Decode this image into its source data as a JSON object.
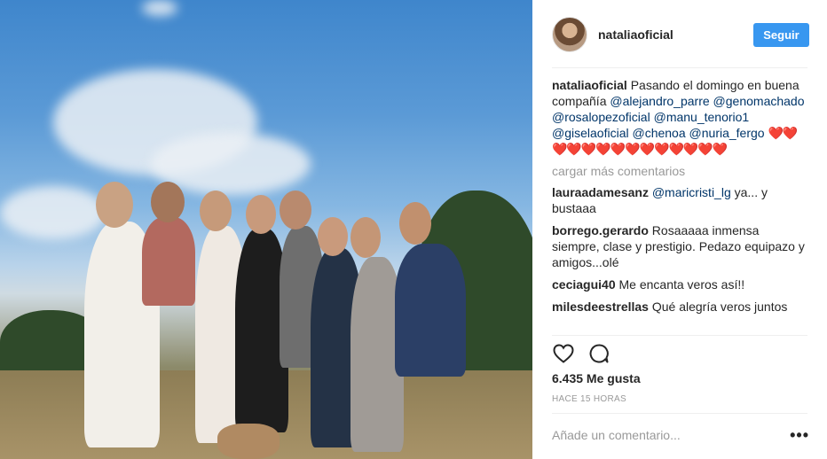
{
  "post": {
    "photo_alt": "group photo outdoors",
    "author": "nataliaoficial",
    "follow_label": "Seguir",
    "caption": {
      "user": "nataliaoficial",
      "text": "Pasando el domingo en buena compañía",
      "mentions": [
        "@alejandro_parre",
        "@genomachado",
        "@rosalopezoficial",
        "@manu_tenorio1",
        "@giselaoficial",
        "@chenoa",
        "@nuria_fergo"
      ],
      "hearts": "❤️❤️❤️❤️❤️❤️❤️❤️❤️❤️❤️❤️❤️❤️"
    },
    "load_more": "cargar más comentarios",
    "comments": [
      {
        "user": "lauraadamesanz",
        "mention": "@maricristi_lg",
        "text": "ya... y bustaaa"
      },
      {
        "user": "borrego.gerardo",
        "text": "Rosaaaaa inmensa siempre, clase y prestigio. Pedazo equipazo y amigos...olé"
      },
      {
        "user": "ceciagui40",
        "text": "Me encanta veros así!!"
      },
      {
        "user": "milesdeestrellas",
        "text": "Qué alegría veros juntos"
      }
    ],
    "likes": "6.435 Me gusta",
    "time": "HACE 15 HORAS",
    "add_comment_placeholder": "Añade un comentario...",
    "more_options": "•••",
    "icons": [
      "heart-icon",
      "comment-icon",
      "more-options-icon"
    ]
  },
  "colors": {
    "accent": "#3897f0",
    "mention": "#003569",
    "muted": "#999999",
    "heart": "#ed1c24"
  }
}
